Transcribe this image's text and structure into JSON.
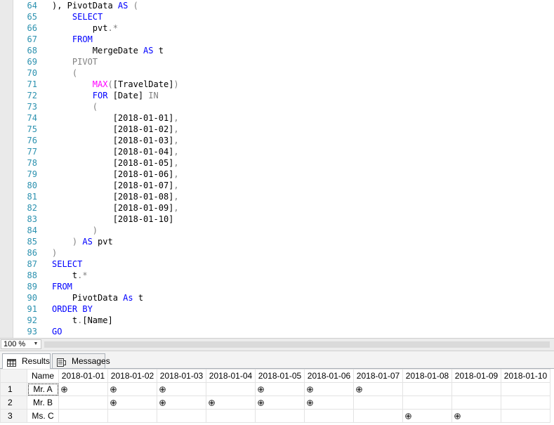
{
  "editor": {
    "lines": [
      {
        "n": "64",
        "tokens": [
          {
            "t": "), PivotData ",
            "c": "plain"
          },
          {
            "t": "AS",
            "c": "kw"
          },
          {
            "t": " (",
            "c": "gray"
          }
        ]
      },
      {
        "n": "65",
        "tokens": [
          {
            "t": "    ",
            "c": "plain"
          },
          {
            "t": "SELECT",
            "c": "kw"
          }
        ]
      },
      {
        "n": "66",
        "tokens": [
          {
            "t": "        pvt",
            "c": "plain"
          },
          {
            "t": ".*",
            "c": "gray"
          }
        ]
      },
      {
        "n": "67",
        "tokens": [
          {
            "t": "    ",
            "c": "plain"
          },
          {
            "t": "FROM",
            "c": "kw"
          }
        ]
      },
      {
        "n": "68",
        "tokens": [
          {
            "t": "        MergeDate ",
            "c": "plain"
          },
          {
            "t": "AS",
            "c": "kw"
          },
          {
            "t": " t",
            "c": "plain"
          }
        ]
      },
      {
        "n": "69",
        "tokens": [
          {
            "t": "    ",
            "c": "plain"
          },
          {
            "t": "PIVOT",
            "c": "gray"
          }
        ]
      },
      {
        "n": "70",
        "tokens": [
          {
            "t": "    ",
            "c": "plain"
          },
          {
            "t": "(",
            "c": "gray"
          }
        ]
      },
      {
        "n": "71",
        "tokens": [
          {
            "t": "        ",
            "c": "plain"
          },
          {
            "t": "MAX",
            "c": "fn"
          },
          {
            "t": "(",
            "c": "gray"
          },
          {
            "t": "[TravelDate]",
            "c": "plain"
          },
          {
            "t": ")",
            "c": "gray"
          }
        ]
      },
      {
        "n": "72",
        "tokens": [
          {
            "t": "        ",
            "c": "plain"
          },
          {
            "t": "FOR",
            "c": "kw"
          },
          {
            "t": " [Date] ",
            "c": "plain"
          },
          {
            "t": "IN",
            "c": "gray"
          }
        ]
      },
      {
        "n": "73",
        "tokens": [
          {
            "t": "        ",
            "c": "plain"
          },
          {
            "t": "(",
            "c": "gray"
          }
        ]
      },
      {
        "n": "74",
        "tokens": [
          {
            "t": "            [2018-01-01]",
            "c": "plain"
          },
          {
            "t": ",",
            "c": "gray"
          }
        ]
      },
      {
        "n": "75",
        "tokens": [
          {
            "t": "            [2018-01-02]",
            "c": "plain"
          },
          {
            "t": ",",
            "c": "gray"
          }
        ]
      },
      {
        "n": "76",
        "tokens": [
          {
            "t": "            [2018-01-03]",
            "c": "plain"
          },
          {
            "t": ",",
            "c": "gray"
          }
        ]
      },
      {
        "n": "77",
        "tokens": [
          {
            "t": "            [2018-01-04]",
            "c": "plain"
          },
          {
            "t": ",",
            "c": "gray"
          }
        ]
      },
      {
        "n": "78",
        "tokens": [
          {
            "t": "            [2018-01-05]",
            "c": "plain"
          },
          {
            "t": ",",
            "c": "gray"
          }
        ]
      },
      {
        "n": "79",
        "tokens": [
          {
            "t": "            [2018-01-06]",
            "c": "plain"
          },
          {
            "t": ",",
            "c": "gray"
          }
        ]
      },
      {
        "n": "80",
        "tokens": [
          {
            "t": "            [2018-01-07]",
            "c": "plain"
          },
          {
            "t": ",",
            "c": "gray"
          }
        ]
      },
      {
        "n": "81",
        "tokens": [
          {
            "t": "            [2018-01-08]",
            "c": "plain"
          },
          {
            "t": ",",
            "c": "gray"
          }
        ]
      },
      {
        "n": "82",
        "tokens": [
          {
            "t": "            [2018-01-09]",
            "c": "plain"
          },
          {
            "t": ",",
            "c": "gray"
          }
        ]
      },
      {
        "n": "83",
        "tokens": [
          {
            "t": "            [2018-01-10]",
            "c": "plain"
          }
        ]
      },
      {
        "n": "84",
        "tokens": [
          {
            "t": "        ",
            "c": "plain"
          },
          {
            "t": ")",
            "c": "gray"
          }
        ]
      },
      {
        "n": "85",
        "tokens": [
          {
            "t": "    ",
            "c": "plain"
          },
          {
            "t": ")",
            "c": "gray"
          },
          {
            "t": " ",
            "c": "plain"
          },
          {
            "t": "AS",
            "c": "kw"
          },
          {
            "t": " pvt",
            "c": "plain"
          }
        ]
      },
      {
        "n": "86",
        "tokens": [
          {
            "t": ")",
            "c": "gray"
          }
        ]
      },
      {
        "n": "87",
        "tokens": [
          {
            "t": "SELECT",
            "c": "kw"
          }
        ]
      },
      {
        "n": "88",
        "tokens": [
          {
            "t": "    t",
            "c": "plain"
          },
          {
            "t": ".*",
            "c": "gray"
          }
        ]
      },
      {
        "n": "89",
        "tokens": [
          {
            "t": "FROM",
            "c": "kw"
          }
        ]
      },
      {
        "n": "90",
        "tokens": [
          {
            "t": "    PivotData ",
            "c": "plain"
          },
          {
            "t": "As",
            "c": "kw"
          },
          {
            "t": " t",
            "c": "plain"
          }
        ]
      },
      {
        "n": "91",
        "tokens": [
          {
            "t": "ORDER BY",
            "c": "kw"
          }
        ]
      },
      {
        "n": "92",
        "tokens": [
          {
            "t": "    t",
            "c": "plain"
          },
          {
            "t": ".",
            "c": "gray"
          },
          {
            "t": "[Name]",
            "c": "plain"
          }
        ]
      },
      {
        "n": "93",
        "tokens": [
          {
            "t": "GO",
            "c": "kw"
          }
        ]
      }
    ]
  },
  "zoom": {
    "value": "100 %"
  },
  "tabs": {
    "results": {
      "label": "Results",
      "icon": "grid-icon"
    },
    "messages": {
      "label": "Messages",
      "icon": "messages-icon"
    }
  },
  "results": {
    "columns": [
      "Name",
      "2018-01-01",
      "2018-01-02",
      "2018-01-03",
      "2018-01-04",
      "2018-01-05",
      "2018-01-06",
      "2018-01-07",
      "2018-01-08",
      "2018-01-09",
      "2018-01-10"
    ],
    "rows": [
      {
        "num": "1",
        "name": "Mr. A",
        "marks": [
          true,
          true,
          true,
          false,
          true,
          true,
          true,
          false,
          false,
          false
        ]
      },
      {
        "num": "2",
        "name": "Mr. B",
        "marks": [
          false,
          true,
          true,
          true,
          true,
          true,
          false,
          false,
          false,
          false
        ]
      },
      {
        "num": "3",
        "name": "Ms. C",
        "marks": [
          false,
          false,
          false,
          false,
          false,
          false,
          false,
          true,
          true,
          false
        ]
      }
    ]
  },
  "colors": {
    "keyword": "#0000ff",
    "function": "#ff00ff",
    "operator": "#808080",
    "line_number": "#2b91af"
  }
}
